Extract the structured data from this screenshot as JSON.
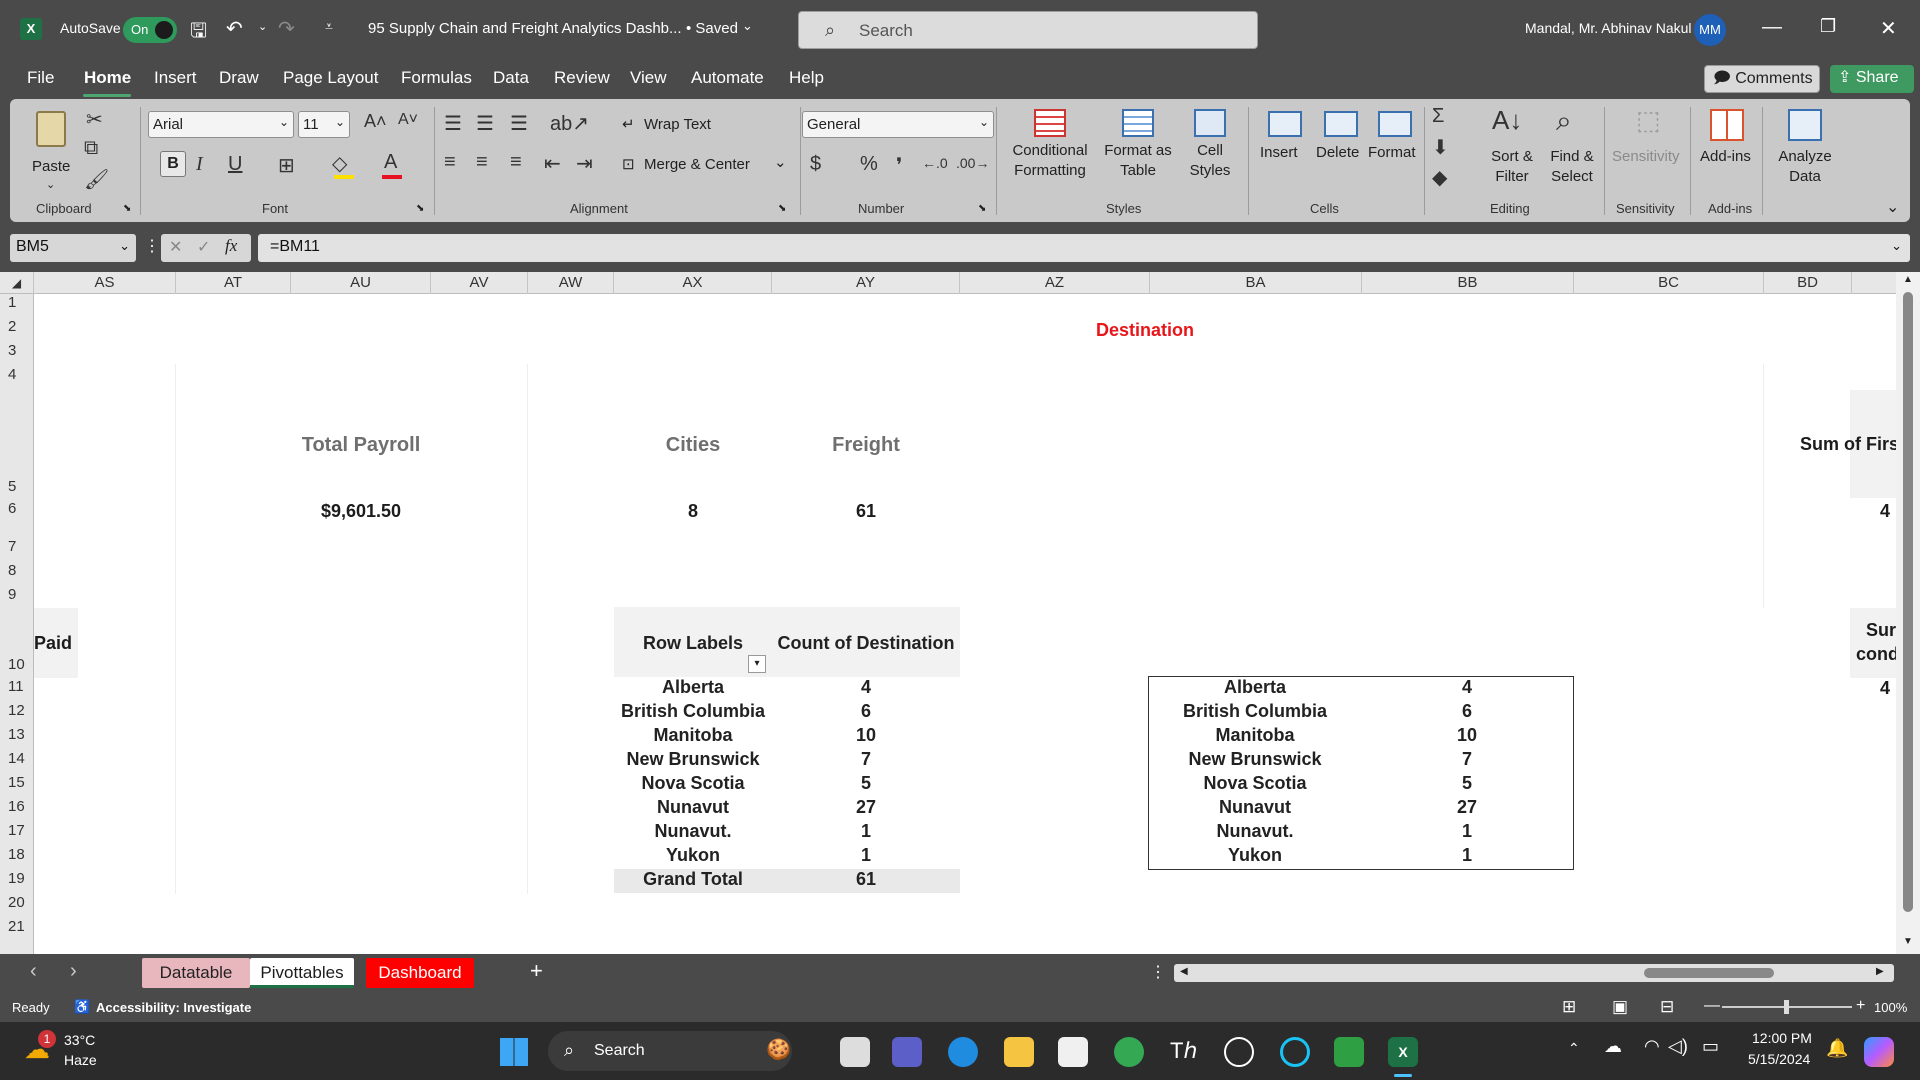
{
  "app": {
    "autosave_label": "AutoSave",
    "autosave_state": "On",
    "doc_title": "95 Supply Chain and Freight Analytics Dashb...",
    "saved_status": "• Saved",
    "search_placeholder": "Search",
    "user_name": "Mandal, Mr. Abhinav Nakul",
    "user_initials": "MM"
  },
  "menu": {
    "tabs": [
      "File",
      "Home",
      "Insert",
      "Draw",
      "Page Layout",
      "Formulas",
      "Data",
      "Review",
      "View",
      "Automate",
      "Help"
    ],
    "comments": "Comments",
    "share": "Share"
  },
  "ribbon": {
    "clipboard": {
      "paste": "Paste",
      "label": "Clipboard"
    },
    "font": {
      "name": "Arial",
      "size": "11",
      "label": "Font"
    },
    "alignment": {
      "wrap": "Wrap Text",
      "merge": "Merge & Center",
      "label": "Alignment"
    },
    "number": {
      "format": "General",
      "label": "Number"
    },
    "styles": {
      "conditional": "Conditional Formatting",
      "format_table": "Format as Table",
      "cell_styles": "Cell Styles",
      "label": "Styles"
    },
    "cells": {
      "insert": "Insert",
      "delete": "Delete",
      "format": "Format",
      "label": "Cells"
    },
    "editing": {
      "sort": "Sort & Filter",
      "find": "Find & Select",
      "label": "Editing"
    },
    "sensitivity": {
      "button": "Sensitivity",
      "label": "Sensitivity"
    },
    "addins": {
      "button": "Add-ins",
      "label": "Add-ins"
    },
    "analyze": {
      "button": "Analyze Data"
    }
  },
  "formula_bar": {
    "name_box": "BM5",
    "formula": "=BM11"
  },
  "columns": [
    "AS",
    "AT",
    "AU",
    "AV",
    "AW",
    "AX",
    "AY",
    "AZ",
    "BA",
    "BB",
    "BC",
    "BD"
  ],
  "rows": [
    "1",
    "2",
    "3",
    "4",
    "5",
    "6",
    "7",
    "8",
    "9",
    "10",
    "11",
    "12",
    "13",
    "14",
    "15",
    "16",
    "17",
    "18",
    "19",
    "20",
    "21"
  ],
  "sheet": {
    "destination_title": "Destination",
    "cards": {
      "payroll_label": "Total Payroll",
      "payroll_value": "$9,601.50",
      "cities_label": "Cities",
      "cities_value": "8",
      "freight_label": "Freight",
      "freight_value": "61",
      "sum_first_label": "Sum of Firs",
      "sum_first_value": "4",
      "paid_label": "Paid",
      "sum_cond_label_1": "Sur",
      "sum_cond_label_2": "cond",
      "sum_cond_value": "4"
    },
    "pivot": {
      "header_labels": "Row Labels",
      "header_count": "Count of Destination",
      "rows": [
        {
          "label": "Alberta",
          "count": "4"
        },
        {
          "label": "British Columbia",
          "count": "6"
        },
        {
          "label": "Manitoba",
          "count": "10"
        },
        {
          "label": "New Brunswick",
          "count": "7"
        },
        {
          "label": "Nova Scotia",
          "count": "5"
        },
        {
          "label": "Nunavut",
          "count": "27"
        },
        {
          "label": "Nunavut.",
          "count": "1"
        },
        {
          "label": "Yukon",
          "count": "1"
        }
      ],
      "grand_total_label": "Grand Total",
      "grand_total_value": "61"
    },
    "copy_table": [
      {
        "label": "Alberta",
        "count": "4"
      },
      {
        "label": "British Columbia",
        "count": "6"
      },
      {
        "label": "Manitoba",
        "count": "10"
      },
      {
        "label": "New Brunswick",
        "count": "7"
      },
      {
        "label": "Nova Scotia",
        "count": "5"
      },
      {
        "label": "Nunavut",
        "count": "27"
      },
      {
        "label": "Nunavut.",
        "count": "1"
      },
      {
        "label": "Yukon",
        "count": "1"
      }
    ]
  },
  "sheet_tabs": [
    "Datatable",
    "Pivottables",
    "Dashboard"
  ],
  "status": {
    "ready": "Ready",
    "accessibility": "Accessibility: Investigate",
    "zoom": "100%"
  },
  "taskbar": {
    "weather_temp": "33°C",
    "weather_desc": "Haze",
    "search": "Search",
    "time": "12:00 PM",
    "date": "5/15/2024",
    "notif_count": "1"
  },
  "colors": {
    "destination_red": "#e8161a",
    "dashboard_tab": "#ff0000",
    "excel_green": "#1e7145"
  }
}
